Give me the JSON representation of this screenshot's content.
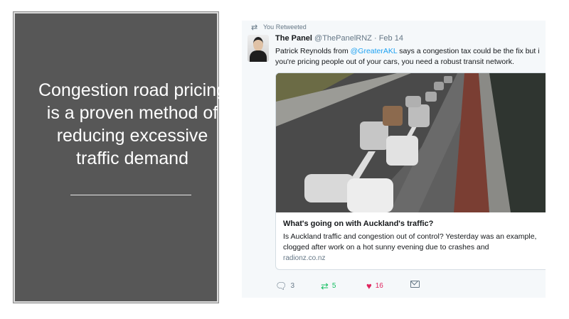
{
  "slide": {
    "headline": "Congestion road pricing is a proven method of reducing excessive traffic demand"
  },
  "tweet": {
    "retweet_label": "You Retweeted",
    "author_name": "The Panel",
    "author_handle": "@ThePanelRNZ",
    "separator": "·",
    "date": "Feb 14",
    "text_part1": "Patrick Reynolds from ",
    "mention": "@GreaterAKL",
    "text_part2": " says a congestion tax could be the fix but i",
    "text_line2": "you're pricing people out of your cars, you need a robust transit network.",
    "card": {
      "title": "What's going on with Auckland's traffic?",
      "description": "Is Auckland traffic and congestion out of control? Yesterday was an example, clogged after work on a hot sunny evening due to crashes and",
      "domain": "radionz.co.nz",
      "image_subject": "motorway traffic congestion photo"
    },
    "actions": {
      "reply_count": "3",
      "retweet_count": "5",
      "like_count": "16"
    },
    "icons": {
      "retweet": "retweet-icon",
      "reply": "reply-icon",
      "like": "heart-icon",
      "message": "message-icon"
    },
    "colors": {
      "link": "#1da1f2",
      "retweet_active": "#17bf63",
      "like_active": "#e0245e",
      "secondary": "#657786"
    }
  }
}
